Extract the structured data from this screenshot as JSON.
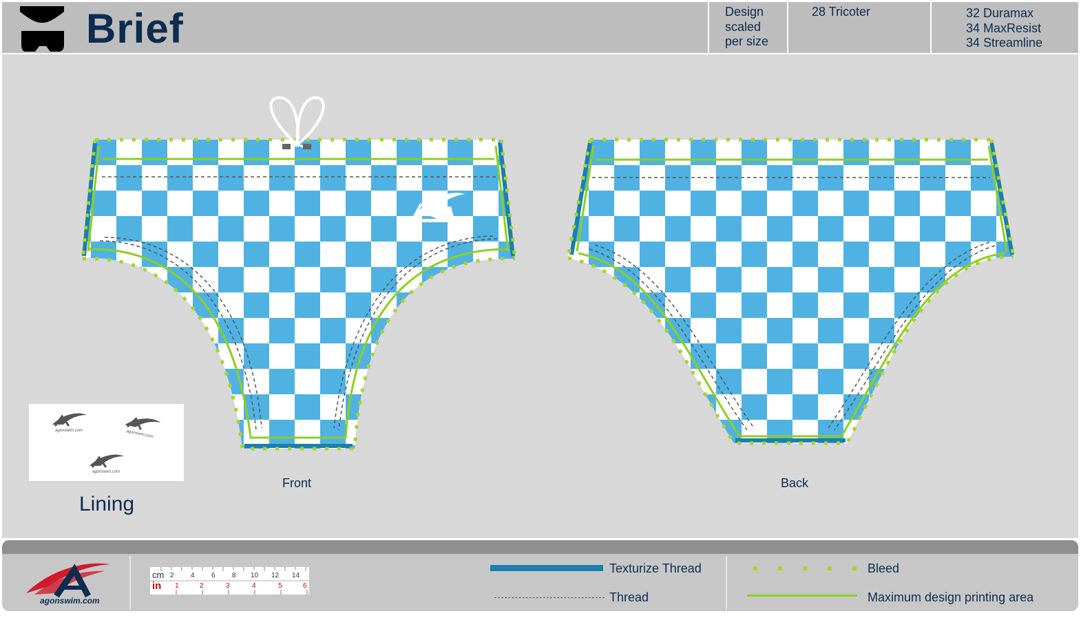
{
  "header": {
    "title": "Brief",
    "icon": "brief-shape-icon",
    "design_note": [
      "Design",
      "scaled",
      "per size"
    ],
    "fabric_1": [
      "28 Tricoter"
    ],
    "fabric_2": [
      "32 Duramax",
      "34 MaxResist",
      "34 Streamline"
    ]
  },
  "views": {
    "front_label": "Front",
    "back_label": "Back",
    "lining_label": "Lining"
  },
  "pattern": {
    "type": "checkerboard",
    "colors": {
      "blue": "#4fb2e3",
      "white": "#ffffff",
      "bleed": "#a6d52a",
      "max_area": "#8ccf1e",
      "texturize": "#1a7fae",
      "thread": "#555555"
    }
  },
  "logo_text": "agonswim.com",
  "ruler": {
    "cm_label": "cm",
    "in_label": "in",
    "cm_ticks": [
      "2",
      "4",
      "6",
      "8",
      "10",
      "12",
      "14"
    ],
    "in_ticks": [
      "1",
      "2",
      "3",
      "4",
      "5",
      "6"
    ]
  },
  "legend": {
    "texturize_thread": "Texturize Thread",
    "thread": "Thread",
    "bleed": "Bleed",
    "max_area": "Maximum design printing area"
  }
}
